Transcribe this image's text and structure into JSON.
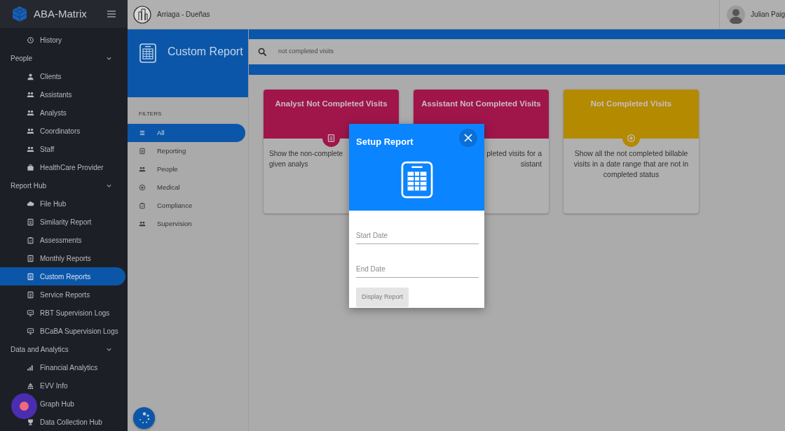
{
  "brand": {
    "name": "ABA-Matrix"
  },
  "topbar": {
    "organization": "Arriaga - Dueñas",
    "user": "Julian Paig"
  },
  "sidebar": {
    "items": [
      {
        "kind": "item",
        "label": "History",
        "selected": false
      },
      {
        "kind": "section",
        "label": "People",
        "expanded": true,
        "children": [
          {
            "kind": "item",
            "label": "Clients",
            "selected": false
          },
          {
            "kind": "item",
            "label": "Assistants",
            "selected": false
          },
          {
            "kind": "item",
            "label": "Analysts",
            "selected": false
          },
          {
            "kind": "item",
            "label": "Coordinators",
            "selected": false
          },
          {
            "kind": "item",
            "label": "Staff",
            "selected": false
          },
          {
            "kind": "item",
            "label": "HealthCare Provider",
            "selected": false
          }
        ]
      },
      {
        "kind": "section",
        "label": "Report Hub",
        "expanded": true,
        "children": [
          {
            "kind": "item",
            "label": "File Hub",
            "selected": false
          },
          {
            "kind": "item",
            "label": "Similarity Report",
            "selected": false
          },
          {
            "kind": "item",
            "label": "Assessments",
            "selected": false
          },
          {
            "kind": "item",
            "label": "Monthly Reports",
            "selected": false
          },
          {
            "kind": "item",
            "label": "Custom Reports",
            "selected": true
          },
          {
            "kind": "item",
            "label": "Service Reports",
            "selected": false
          },
          {
            "kind": "item",
            "label": "RBT Supervision Logs",
            "selected": false
          },
          {
            "kind": "item",
            "label": "BCaBA Supervision Logs",
            "selected": false
          }
        ]
      },
      {
        "kind": "section",
        "label": "Data and Analytics",
        "expanded": true,
        "children": [
          {
            "kind": "item",
            "label": "Financial Analytics",
            "selected": false
          },
          {
            "kind": "item",
            "label": "EVV Info",
            "selected": false
          },
          {
            "kind": "item",
            "label": "Graph Hub",
            "selected": false
          },
          {
            "kind": "item",
            "label": "Data Collection Hub",
            "selected": false
          }
        ]
      }
    ]
  },
  "page": {
    "title": "Custom Report",
    "search": {
      "value": "not completed visits"
    }
  },
  "filters": {
    "heading": "FILTERS",
    "items": [
      {
        "label": "All",
        "selected": true
      },
      {
        "label": "Reporting",
        "selected": false
      },
      {
        "label": "People",
        "selected": false
      },
      {
        "label": "Medical",
        "selected": false
      },
      {
        "label": "Compliance",
        "selected": false
      },
      {
        "label": "Supervision",
        "selected": false
      }
    ]
  },
  "cards": [
    {
      "title": "Analyst Not Completed Visits",
      "color": "#a0154a",
      "description_lines": [
        "Show the non-complete",
        "given analys"
      ]
    },
    {
      "title": "Assistant Not Completed Visits",
      "color": "#a0154a",
      "description_lines": [
        "pleted visits for a",
        "sistant"
      ]
    },
    {
      "title": "Not Completed Visits",
      "color": "#b38a00",
      "description_lines": [
        "Show all the not completed billable",
        "visits in a date range that are not in",
        "completed status"
      ]
    }
  ],
  "modal": {
    "title": "Setup Report",
    "fields": [
      {
        "placeholder": "Start Date"
      },
      {
        "placeholder": "End Date"
      }
    ],
    "button": {
      "label": "Display Report",
      "disabled": true
    }
  }
}
